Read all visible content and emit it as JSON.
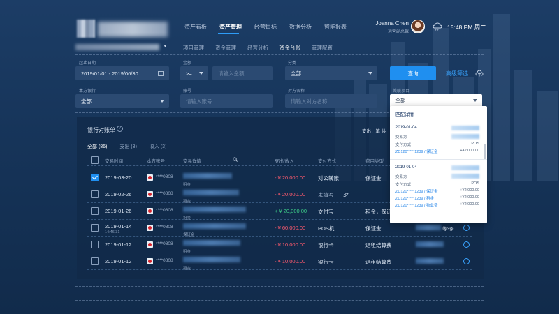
{
  "header": {
    "nav": [
      "资产看板",
      "资产管理",
      "经营目标",
      "数据分析",
      "智能报表"
    ],
    "nav_active": 1,
    "subnav": [
      "项目管理",
      "资金管理",
      "经营分析",
      "资金台账",
      "管理配置"
    ],
    "subnav_active": 3,
    "user_name": "Joanna Chen",
    "user_role": "运营副总裁",
    "time": "15:48 PM 周二"
  },
  "filters": {
    "date_label": "起止日期",
    "date_value": "2019/01/01 - 2019/06/30",
    "amount_label": "金额",
    "amount_op": ">=",
    "amount_placeholder": "请输入金额",
    "category_label": "分类",
    "category_value": "全部",
    "query_button": "查询",
    "advanced": "高级筛选",
    "bank_label": "本方银行",
    "bank_value": "全部",
    "account_label": "账号",
    "account_placeholder": "请输入账号",
    "counterparty_label": "对方名称",
    "counterparty_placeholder": "请输入对方名称",
    "project_label": "关联项目",
    "project_value": "全部"
  },
  "table": {
    "title": "银行对账单",
    "summary": "支出：笔 共",
    "tabs": [
      "全部 (86)",
      "支出 (3)",
      "收入 (3)"
    ],
    "columns": [
      "交易时间",
      "本方账号",
      "交易详情",
      "支出/收入",
      "支付方式",
      "费用类型"
    ],
    "rows": [
      {
        "date": "2019-03-20",
        "time": "",
        "account": "****0808",
        "detail": "租金",
        "amount": "- ¥ 20,000.00",
        "sign": "neg",
        "method": "对公转账",
        "type": "保证金",
        "checked": true
      },
      {
        "date": "2019-02-26",
        "time": "",
        "account": "****0808",
        "detail": "租金",
        "amount": "- ¥ 20,000.00",
        "sign": "neg",
        "method": "未填写",
        "type": "",
        "checked": false
      },
      {
        "date": "2019-01-26",
        "time": "",
        "account": "****0808",
        "detail": "租金",
        "amount": "+ ¥ 20,000.00",
        "sign": "pos",
        "method": "支付宝",
        "type": "租金，保证",
        "checked": false
      },
      {
        "date": "2019-01-14",
        "time": "14:46:31",
        "account": "****0808",
        "detail": "保证金",
        "amount": "- ¥ 60,000.00",
        "sign": "neg",
        "method": "POS机",
        "type": "保证金",
        "checked": false,
        "extra": "等3条"
      },
      {
        "date": "2019-01-12",
        "time": "",
        "account": "****0808",
        "detail": "租金",
        "amount": "- ¥ 10,000.00",
        "sign": "neg",
        "method": "银行卡",
        "type": "退租结算费",
        "checked": false
      },
      {
        "date": "2019-01-12",
        "time": "",
        "account": "****0808",
        "detail": "租金",
        "amount": "- ¥ 10,000.00",
        "sign": "neg",
        "method": "银行卡",
        "type": "退租结算费",
        "checked": false
      }
    ]
  },
  "popup": {
    "title": "匹配详情",
    "groups": [
      {
        "date": "2019-01-04",
        "party_label": "交易方",
        "method_label": "支付方式",
        "method_value": "POS",
        "items": [
          {
            "ref": "ZD120*****1239 / 保证金",
            "amount": "+¥2,000.00"
          }
        ]
      },
      {
        "date": "2019-01-04",
        "party_label": "交易方",
        "method_label": "支付方式",
        "method_value": "POS",
        "items": [
          {
            "ref": "ZD120*****1239 / 保证金",
            "amount": "+¥2,000.00"
          },
          {
            "ref": "ZD120*****1239 / 租金",
            "amount": "+¥2,000.00"
          },
          {
            "ref": "ZD120*****1239 / 物业费",
            "amount": "+¥2,000.00"
          }
        ]
      }
    ]
  },
  "colors": {
    "accent": "#1f8ff0",
    "negative": "#ff5a6e",
    "positive": "#3ed08a",
    "background": "#163459"
  }
}
